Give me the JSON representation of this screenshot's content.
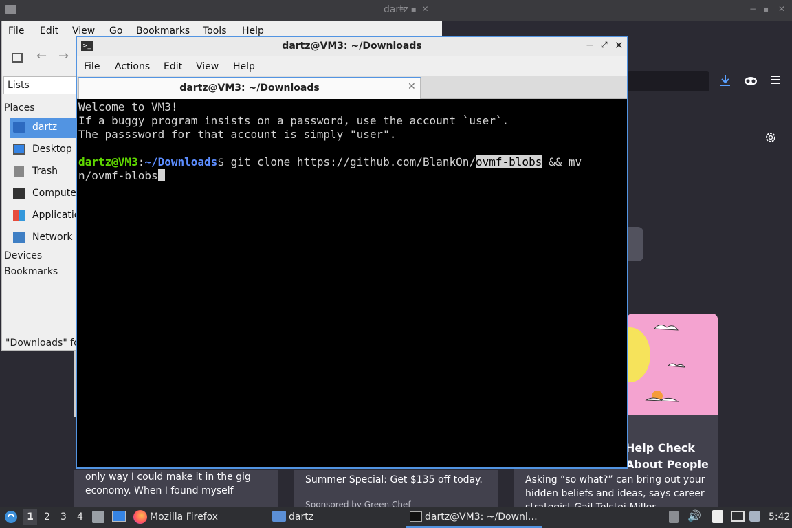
{
  "firefox": {
    "window_title": "dartz",
    "cards": [
      {
        "text": "only way I could make it in the gig economy. When I found myself sleepin…"
      },
      {
        "text": "Summer Special: Get $135 off today.",
        "sponsor": "Sponsored by Green Chef"
      },
      {
        "title": "Help Check About People",
        "text": "Asking “so what?” can bring out your hidden beliefs and ideas, says career strategist Gail Tolstoi-Miller."
      }
    ],
    "icons": [
      "download-icon",
      "mask-icon",
      "hamburger-menu-icon",
      "gear-icon"
    ]
  },
  "file_manager": {
    "menu": [
      "File",
      "Edit",
      "View",
      "Go",
      "Bookmarks",
      "Tools",
      "Help"
    ],
    "side_mode": "Lists",
    "places_label": "Places",
    "places": [
      {
        "label": "dartz",
        "icon": "home-folder-icon",
        "selected": true
      },
      {
        "label": "Desktop",
        "icon": "desktop-icon"
      },
      {
        "label": "Trash",
        "icon": "trash-icon"
      },
      {
        "label": "Computer",
        "icon": "computer-icon"
      },
      {
        "label": "Applications",
        "icon": "applications-icon"
      },
      {
        "label": "Network",
        "icon": "network-icon"
      }
    ],
    "devices_label": "Devices",
    "bookmarks_label": "Bookmarks",
    "status": "\"Downloads\" fo"
  },
  "terminal": {
    "window_title": "dartz@VM3: ~/Downloads",
    "menu": [
      "File",
      "Actions",
      "Edit",
      "View",
      "Help"
    ],
    "tab_title": "dartz@VM3: ~/Downloads",
    "welcome": [
      "Welcome to VM3!",
      "If a buggy program insists on a password, use the account `user`.",
      "The passsword for that account is simply \"user\"."
    ],
    "prompt_user": "dartz@VM3",
    "prompt_sep": ":",
    "prompt_path": "~/Downloads",
    "prompt_dollar": "$",
    "cmd_before": " git clone https://github.com/BlankOn/",
    "cmd_highlight": "ovmf-blobs",
    "cmd_after": " && mv",
    "cmd_line2": "n/ovmf-blobs"
  },
  "taskbar": {
    "workspaces": [
      "1",
      "2",
      "3",
      "4"
    ],
    "tasks": [
      "Mozilla Firefox",
      "dartz",
      "dartz@VM3: ~/Downl…"
    ],
    "clock": "5:42"
  },
  "colors": {
    "accent": "#5294e2",
    "prompt_green": "#5fd700",
    "prompt_blue": "#5c8dff"
  }
}
